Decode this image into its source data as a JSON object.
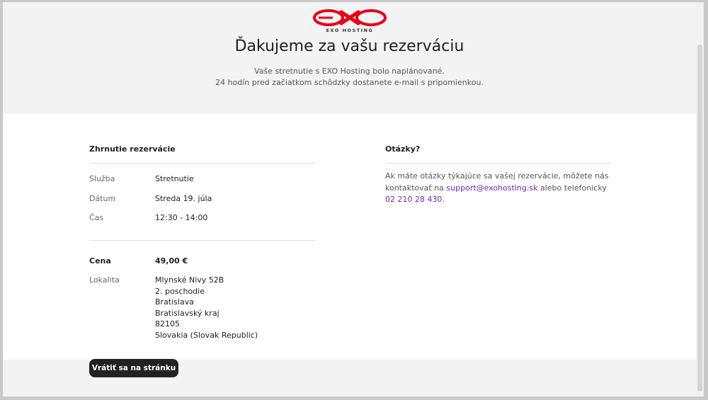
{
  "brand": {
    "logo_text": "EXO HOSTING"
  },
  "hero": {
    "title": "Ďakujeme za vašu rezerváciu",
    "line1": "Vaše stretnutie s EXO Hosting bolo naplánované.",
    "line2": "24 hodín pred začiatkom schôdzky dostanete e-mail s pripomienkou."
  },
  "summary": {
    "title": "Zhrnutie rezervácie",
    "rows": [
      {
        "label": "Služba",
        "value": "Stretnutie"
      },
      {
        "label": "Dátum",
        "value": "Streda 19. júla"
      },
      {
        "label": "Čas",
        "value": "12:30 - 14:00"
      }
    ],
    "price_label": "Cena",
    "price_value": "49,00 €",
    "location_label": "Lokalita",
    "address": [
      "Mlynské Nivy 52B",
      "2. poschodie",
      "Bratislava",
      "Bratislavský kraj",
      "82105",
      "Slovakia (Slovak Republic)"
    ]
  },
  "questions": {
    "title": "Otázky?",
    "text_before": "Ak máte otázky týkajúce sa vašej rezervácie, môžete nás kontaktovať na ",
    "email": "support@exohosting.sk",
    "text_middle": " alebo telefonicky ",
    "phone": "02 210 28 430",
    "text_after": "."
  },
  "back_button": {
    "label": "Vrátiť sa na stránku"
  },
  "colors": {
    "accent": "#6a2bb5",
    "logo_red": "#e3001b",
    "button_bg": "#222222"
  }
}
